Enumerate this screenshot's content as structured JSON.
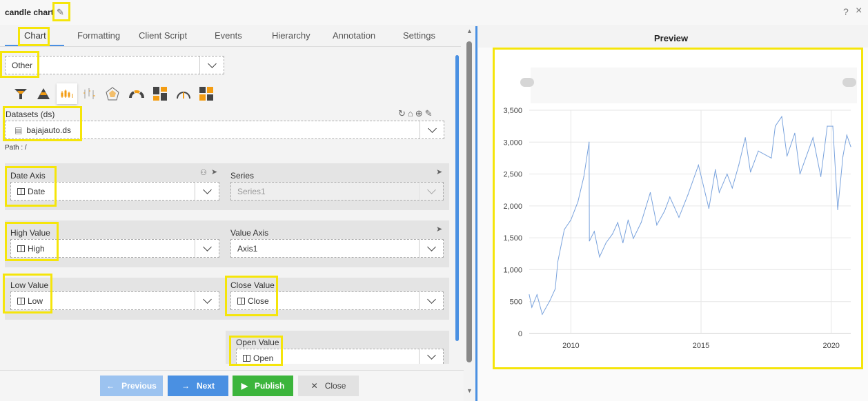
{
  "window": {
    "title": "candle chart",
    "help": "?",
    "close": "×"
  },
  "tabs": [
    {
      "label": "Chart",
      "active": true
    },
    {
      "label": "Formatting"
    },
    {
      "label": "Client Script"
    },
    {
      "label": "Events"
    },
    {
      "label": "Hierarchy"
    },
    {
      "label": "Annotation"
    },
    {
      "label": "Settings"
    }
  ],
  "chart_type": {
    "value": "Other"
  },
  "chart_icons": [
    "funnel-icon",
    "pyramid-icon",
    "candlestick-icon",
    "ohlc-icon",
    "radar-icon",
    "semi-donut-icon",
    "treemap-icon",
    "gauge-icon",
    "heatmap-icon"
  ],
  "datasets": {
    "label": "Datasets (ds)",
    "value": "bajajauto.ds",
    "path": "Path : /"
  },
  "fields": {
    "date_axis": {
      "label": "Date Axis",
      "value": "Date"
    },
    "series": {
      "label": "Series",
      "value": "Series1"
    },
    "high": {
      "label": "High Value",
      "value": "High"
    },
    "value_axis": {
      "label": "Value Axis",
      "value": "Axis1"
    },
    "low": {
      "label": "Low Value",
      "value": "Low"
    },
    "close": {
      "label": "Close Value",
      "value": "Close"
    },
    "open": {
      "label": "Open Value",
      "value": "Open"
    }
  },
  "buttons": {
    "previous": "Previous",
    "next": "Next",
    "publish": "Publish",
    "close": "Close"
  },
  "preview": {
    "title": "Preview"
  },
  "colors": {
    "accent": "#4a90e2",
    "publish": "#3cb53c",
    "highlight": "#f5e50a",
    "line": "#7aa3dd"
  },
  "chart_data": {
    "type": "line",
    "xlim": [
      2008.4,
      2020.75
    ],
    "ylim": [
      0,
      3500
    ],
    "xticks": [
      "2010",
      "2015",
      "2020"
    ],
    "yticks": [
      "0",
      "500",
      "1,000",
      "1,500",
      "2,000",
      "2,500",
      "3,000",
      "3,500"
    ],
    "grid": true,
    "x": [
      2008.4,
      2008.5,
      2008.7,
      2008.9,
      2009.2,
      2009.4,
      2009.5,
      2009.75,
      2010.0,
      2010.27,
      2010.5,
      2010.7,
      2010.71,
      2010.9,
      2011.1,
      2011.35,
      2011.6,
      2011.8,
      2012.0,
      2012.2,
      2012.4,
      2012.7,
      2013.05,
      2013.3,
      2013.6,
      2013.8,
      2014.15,
      2014.5,
      2014.9,
      2015.3,
      2015.55,
      2015.7,
      2016.0,
      2016.2,
      2016.45,
      2016.7,
      2016.9,
      2017.2,
      2017.7,
      2017.85,
      2018.1,
      2018.3,
      2018.6,
      2018.8,
      2019.3,
      2019.6,
      2019.85,
      2020.06,
      2020.25,
      2020.45,
      2020.6,
      2020.75
    ],
    "y": [
      608,
      410,
      608,
      300,
      520,
      700,
      1130,
      1630,
      1780,
      2065,
      2460,
      3000,
      1450,
      1600,
      1200,
      1420,
      1560,
      1740,
      1420,
      1780,
      1490,
      1740,
      2210,
      1700,
      1920,
      2140,
      1820,
      2180,
      2640,
      1960,
      2570,
      2210,
      2500,
      2280,
      2640,
      3070,
      2530,
      2860,
      2750,
      3250,
      3400,
      2780,
      3140,
      2500,
      3070,
      2460,
      3250,
      3250,
      1940,
      2780,
      3110,
      2930
    ]
  }
}
